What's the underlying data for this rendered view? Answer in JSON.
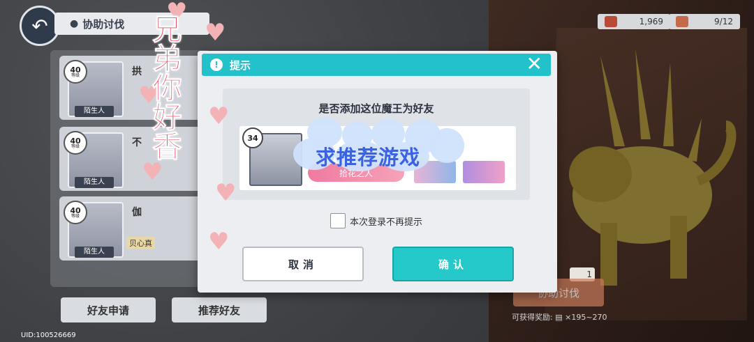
{
  "header": {
    "back_icon": "back-arrow-icon",
    "title": "协助讨伐",
    "location_icon": "location-pin-icon"
  },
  "resources": [
    {
      "icon": "coin-badge-icon",
      "value": "1,969"
    },
    {
      "icon": "ticket-icon",
      "value": "9/12"
    }
  ],
  "friend_list": [
    {
      "level": "40",
      "level_unit": "等级",
      "name": "拱",
      "relation": "陌生人"
    },
    {
      "level": "40",
      "level_unit": "等级",
      "name": "不",
      "relation": "陌生人"
    },
    {
      "level": "40",
      "level_unit": "等级",
      "name": "伽",
      "relation": "陌生人",
      "extra_tag": "贝心真"
    }
  ],
  "bottom_buttons": {
    "friend_request": "好友申请",
    "recommend_friend": "推荐好友"
  },
  "uid": "UID:100526669",
  "battle": {
    "ticket_count": "1",
    "assist_label": "协助讨伐",
    "reward_label": "可获得奖励:",
    "reward_range": "×195~270"
  },
  "dialog": {
    "title": "提示",
    "question": "是否添加这位魔王为好友",
    "user": {
      "level": "34",
      "title_tag": "拾花之人"
    },
    "checkbox_label": "本次登录不再提示",
    "cancel_label": "取消",
    "confirm_label": "确认"
  },
  "stickers": {
    "pink_text": "兄弟你好香",
    "blue_text": "求推荐游戏"
  },
  "colors": {
    "accent": "#23c1c9",
    "confirm": "#26c9c9",
    "sticker_pink": "#e94b64",
    "sticker_blue": "#3a62e3"
  }
}
